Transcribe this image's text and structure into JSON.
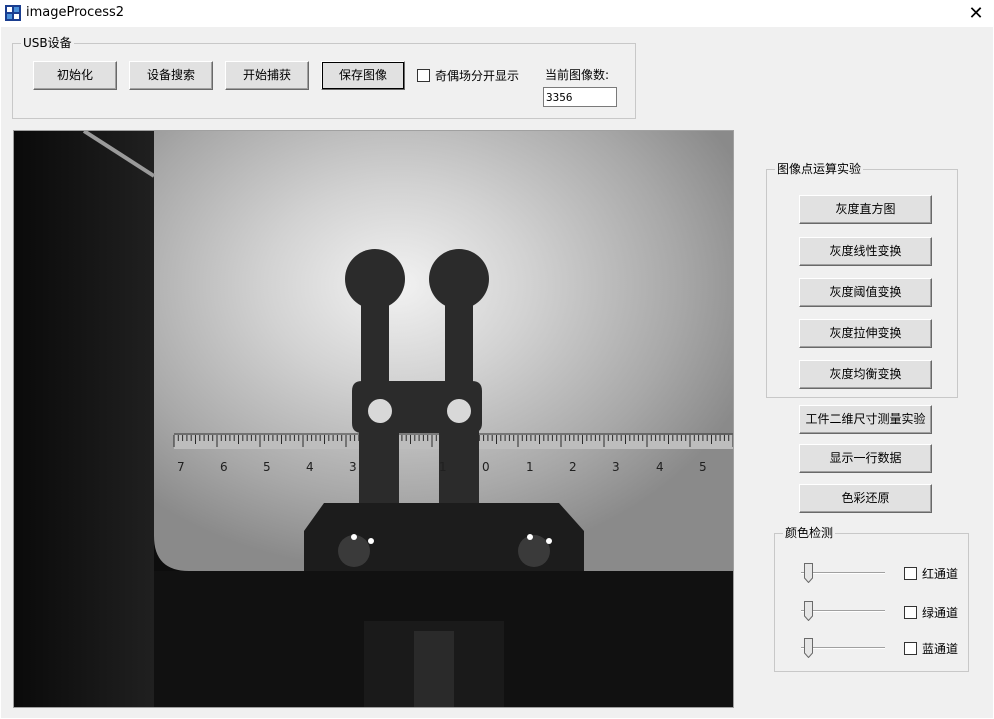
{
  "window": {
    "title": "imageProcess2",
    "close_glyph": "✕"
  },
  "usb_group": {
    "title": "USB设备",
    "buttons": [
      "初始化",
      "设备搜索",
      "开始捕获",
      "保存图像"
    ],
    "checkbox_label": "奇偶场分开显示",
    "count_label": "当前图像数:",
    "count_value": "3356"
  },
  "point_ops_group": {
    "title": "图像点运算实验",
    "buttons": [
      "灰度直方图",
      "灰度线性变换",
      "灰度阈值变换",
      "灰度拉伸变换",
      "灰度均衡变换"
    ]
  },
  "extra_buttons": [
    "工件二维尺寸测量实验",
    "显示一行数据",
    "色彩还原"
  ],
  "color_detect_group": {
    "title": "颜色检测",
    "channels": [
      "红通道",
      "绿通道",
      "蓝通道"
    ]
  },
  "ruler": {
    "labels": [
      "7",
      "6",
      "5",
      "4",
      "3",
      "1",
      "0",
      "1",
      "2",
      "3",
      "4",
      "5"
    ]
  },
  "icons": {
    "app": "app-icon",
    "close": "close-icon"
  }
}
